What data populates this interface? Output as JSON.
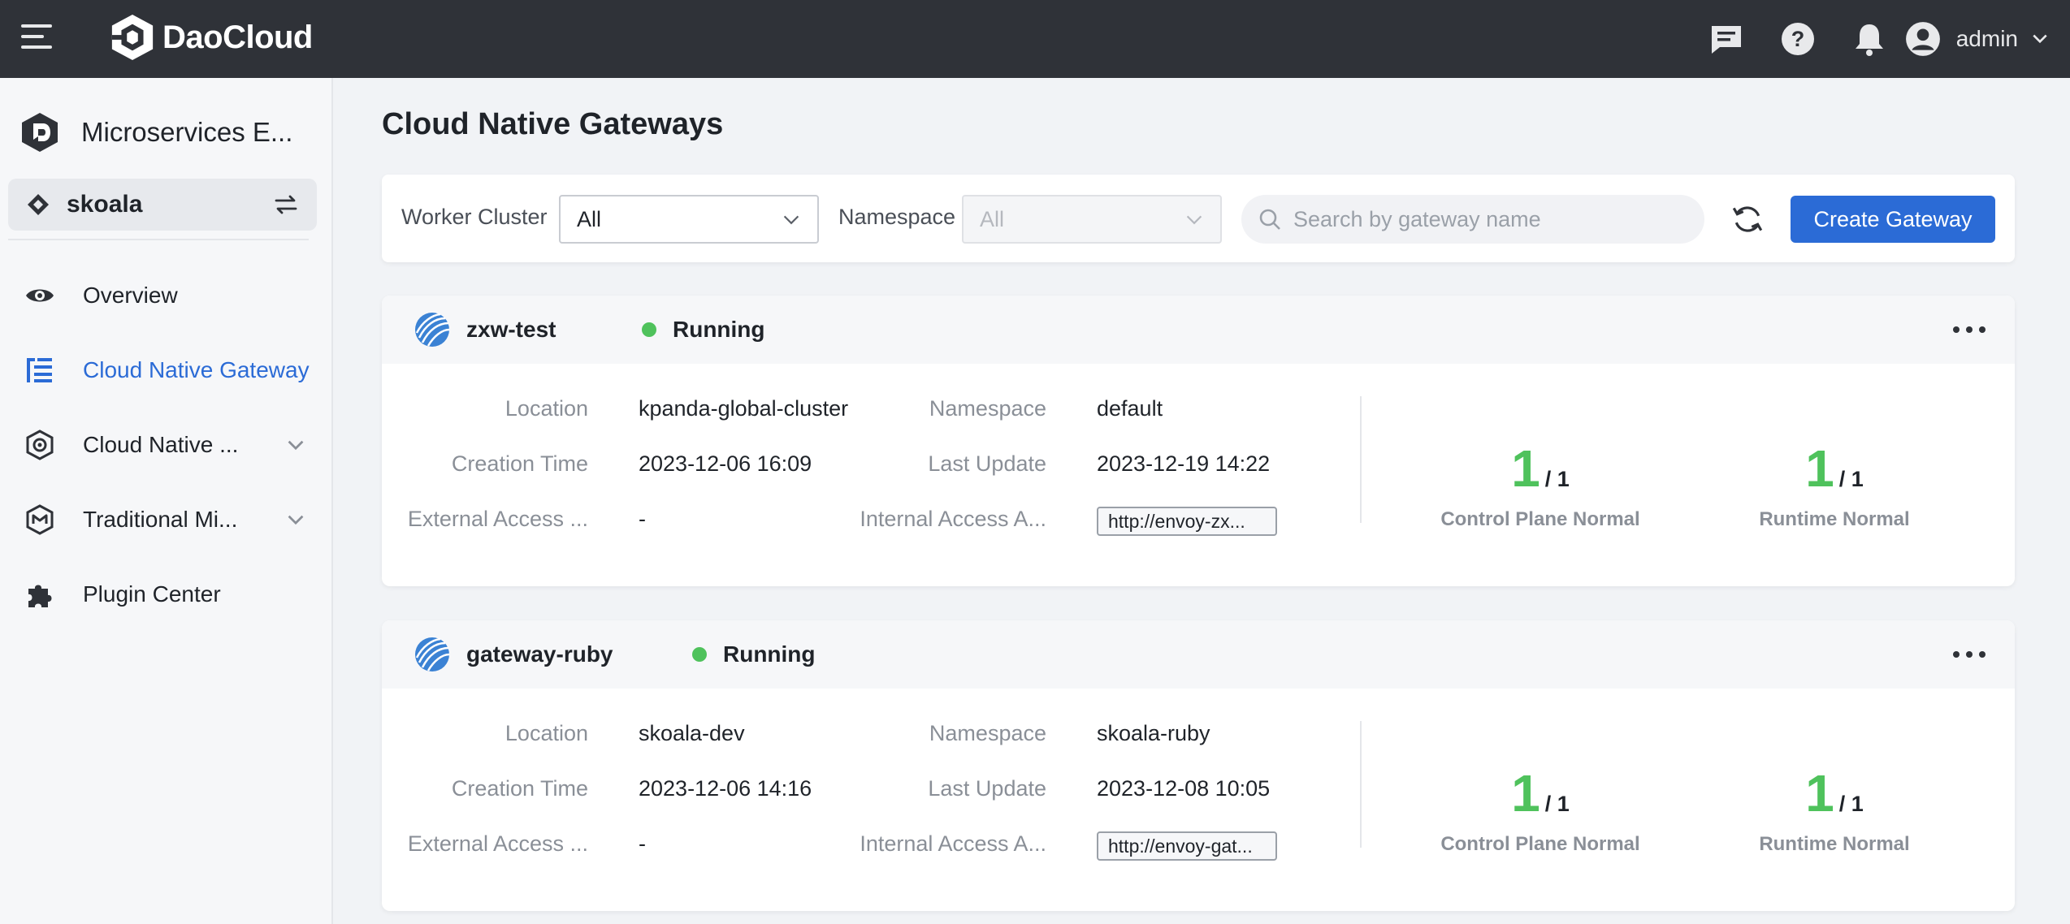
{
  "topbar": {
    "brand": "DaoCloud",
    "user": "admin",
    "icons": [
      "menu-icon",
      "message-icon",
      "help-icon",
      "bell-icon",
      "user-avatar-icon",
      "chevron-down-icon"
    ]
  },
  "sidebar": {
    "module_title": "Microservices E...",
    "workspace": "skoala",
    "items": [
      {
        "label": "Overview",
        "icon": "eye-icon",
        "active": false,
        "expandable": false
      },
      {
        "label": "Cloud Native Gateway",
        "icon": "gateway-list-icon",
        "active": true,
        "expandable": false
      },
      {
        "label": "Cloud Native ...",
        "icon": "cloud-native-icon",
        "active": false,
        "expandable": true
      },
      {
        "label": "Traditional Mi...",
        "icon": "traditional-icon",
        "active": false,
        "expandable": true
      },
      {
        "label": "Plugin Center",
        "icon": "puzzle-icon",
        "active": false,
        "expandable": false
      }
    ]
  },
  "main": {
    "title": "Cloud Native Gateways",
    "filters": {
      "worker_cluster_label": "Worker Cluster",
      "worker_cluster_value": "All",
      "namespace_label": "Namespace",
      "namespace_value": "All",
      "search_placeholder": "Search by gateway name",
      "create_label": "Create Gateway"
    },
    "labels": {
      "location": "Location",
      "namespace": "Namespace",
      "creation_time": "Creation Time",
      "last_update": "Last Update",
      "external_access": "External Access ...",
      "internal_access": "Internal Access A...",
      "control_plane": "Control Plane Normal",
      "runtime": "Runtime Normal"
    },
    "gateways": [
      {
        "name": "zxw-test",
        "status": "Running",
        "location": "kpanda-global-cluster",
        "namespace": "default",
        "creation_time": "2023-12-06 16:09",
        "last_update": "2023-12-19 14:22",
        "external_access": "-",
        "internal_access": "http://envoy-zx...",
        "control_plane_ready": "1",
        "control_plane_total": "/ 1",
        "runtime_ready": "1",
        "runtime_total": "/ 1"
      },
      {
        "name": "gateway-ruby",
        "status": "Running",
        "location": "skoala-dev",
        "namespace": "skoala-ruby",
        "creation_time": "2023-12-06 14:16",
        "last_update": "2023-12-08 10:05",
        "external_access": "-",
        "internal_access": "http://envoy-gat...",
        "control_plane_ready": "1",
        "control_plane_total": "/ 1",
        "runtime_ready": "1",
        "runtime_total": "/ 1"
      }
    ]
  },
  "colors": {
    "topbar": "#2f3238",
    "accent": "#2b6bd6",
    "running": "#4fc25c"
  }
}
